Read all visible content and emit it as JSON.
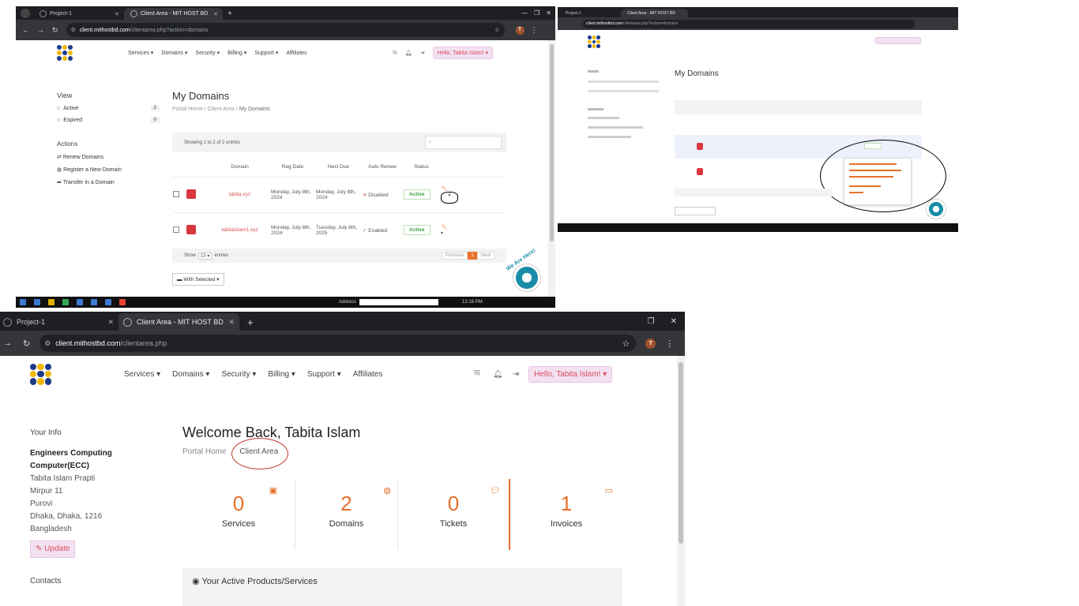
{
  "colors": {
    "accent": "#e8702a",
    "brand_blue": "#1d3a8a",
    "brand_yellow": "#f2b705",
    "danger": "#d9534f",
    "success": "#3c9d3c"
  },
  "brand": {
    "site_name": "MIT HOST BD"
  },
  "shot1": {
    "tabs": [
      {
        "label": "Project-1"
      },
      {
        "label": "Client Area - MIT HOST BD"
      }
    ],
    "url": {
      "domain": "client.mithostbd.com",
      "path": "/clientarea.php?action=domains"
    },
    "profile_letter": "T",
    "nav": {
      "items": [
        "Services",
        "Domains",
        "Security",
        "Billing",
        "Support",
        "Affiliates"
      ],
      "hello": "Hello, Tabita Islam!"
    },
    "sidebar": {
      "view_title": "View",
      "view_items": [
        {
          "label": "Active",
          "count": "2"
        },
        {
          "label": "Expired",
          "count": "0"
        }
      ],
      "actions_title": "Actions",
      "action_items": [
        "Renew Domains",
        "Register a New Domain",
        "Transfer in a Domain"
      ]
    },
    "page_title": "My Domains",
    "breadcrumb": [
      "Portal Home",
      "Client Area",
      "My Domains"
    ],
    "showing": "Showing 1 to 2 of 2 entries",
    "columns": [
      "Domain",
      "Reg Date",
      "Next Due",
      "Auto Renew",
      "Status"
    ],
    "rows": [
      {
        "domain": "tabita.xyz",
        "reg_date": "Monday, July 8th, 2024",
        "next_due": "Monday, July 8th, 2024",
        "auto_renew": "Disabled",
        "status": "Active"
      },
      {
        "domain": "tabitaislam1.xyz",
        "reg_date": "Monday, July 8th, 2024",
        "next_due": "Tuesday, July 8th, 2025",
        "auto_renew": "Enabled",
        "status": "Active"
      }
    ],
    "show_entries": {
      "show": "Show",
      "value": "10",
      "entries": "entries"
    },
    "pagination": {
      "prev": "Previous",
      "page": "1",
      "next": "Next"
    },
    "with_selected": "With Selected",
    "we_are_here": "We Are Here!",
    "taskbar": {
      "address": "Address",
      "time": "12:16 PM"
    }
  },
  "shot2": {
    "page_title": "My Domains"
  },
  "shot3": {
    "tabs": [
      {
        "label": "Project-1"
      },
      {
        "label": "Client Area - MIT HOST BD"
      }
    ],
    "url": {
      "domain": "client.mithostbd.com",
      "path": "/clientarea.php"
    },
    "profile_letter": "T",
    "nav": {
      "items": [
        "Services",
        "Domains",
        "Security",
        "Billing",
        "Support",
        "Affiliates"
      ],
      "hello": "Hello, Tabita Islam!"
    },
    "your_info_title": "Your Info",
    "info_lines": [
      "Engineers Computing",
      "Computer(ECC)",
      "Tabita Islam Prapti",
      "Mirpur 11",
      "Purovi",
      "Dhaka, Dhaka, 1216",
      "Bangladesh"
    ],
    "update_label": "Update",
    "contacts_title": "Contacts",
    "welcome": "Welcome Back, Tabita Islam",
    "breadcrumb": [
      "Portal Home",
      "Client Area"
    ],
    "stats": [
      {
        "value": "0",
        "label": "Services"
      },
      {
        "value": "2",
        "label": "Domains"
      },
      {
        "value": "0",
        "label": "Tickets"
      },
      {
        "value": "1",
        "label": "Invoices"
      }
    ],
    "active_products": "Your Active Products/Services"
  }
}
